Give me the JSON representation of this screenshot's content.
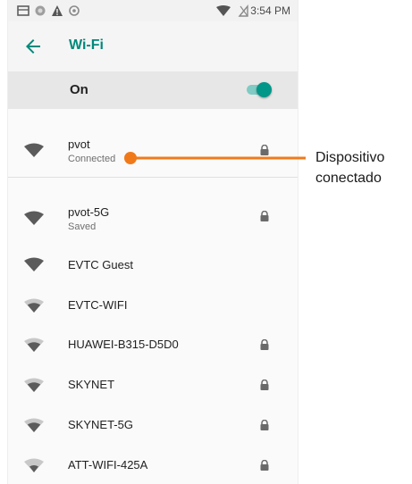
{
  "status_bar": {
    "time": "3:54 PM",
    "icons": [
      "sd-card-icon",
      "sync-icon",
      "alert-icon",
      "settings-icon",
      "wifi-icon",
      "battery-icon"
    ]
  },
  "app_bar": {
    "title": "Wi-Fi",
    "back_icon": "arrow-back-icon",
    "accent_color": "#00897b"
  },
  "wifi_toggle": {
    "label": "On",
    "state": "on",
    "color": "#009688"
  },
  "networks": [
    {
      "name": "pvot",
      "status": "Connected",
      "secured": true,
      "signal": "strong"
    },
    {
      "name": "pvot-5G",
      "status": "Saved",
      "secured": true,
      "signal": "strong"
    },
    {
      "name": "EVTC Guest",
      "status": "",
      "secured": false,
      "signal": "strong"
    },
    {
      "name": "EVTC-WIFI",
      "status": "",
      "secured": false,
      "signal": "medium"
    },
    {
      "name": "HUAWEI-B315-D5D0",
      "status": "",
      "secured": true,
      "signal": "medium"
    },
    {
      "name": "SKYNET",
      "status": "",
      "secured": true,
      "signal": "medium"
    },
    {
      "name": "SKYNET-5G",
      "status": "",
      "secured": true,
      "signal": "medium"
    },
    {
      "name": "ATT-WIFI-425A",
      "status": "",
      "secured": true,
      "signal": "weak"
    }
  ],
  "annotation": {
    "line1": "Dispositivo",
    "line2": "conectado",
    "color": "#f07a1a"
  }
}
